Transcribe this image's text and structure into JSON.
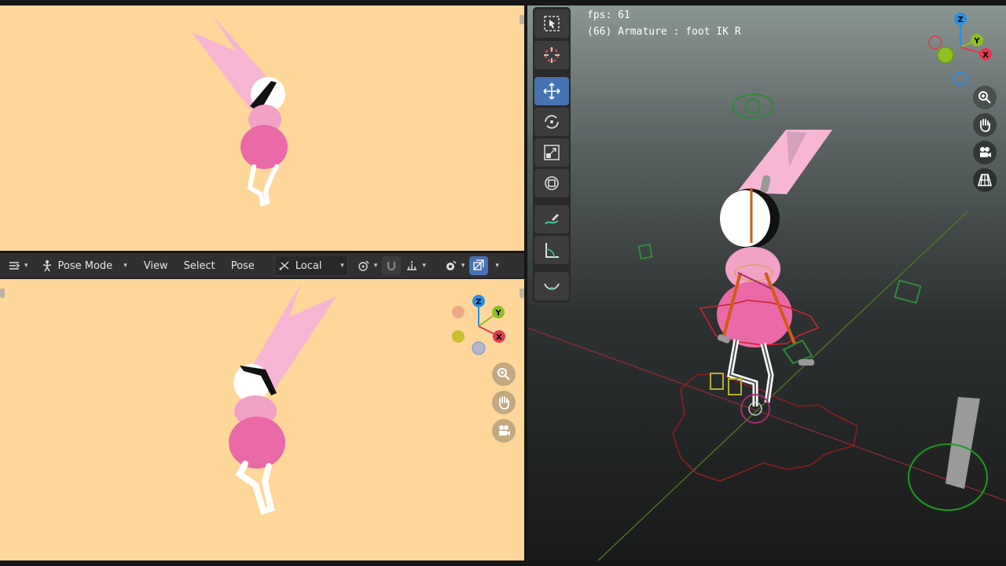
{
  "header": {
    "editor_type_icon": "editor-type-icon",
    "mode_label": "Pose Mode",
    "menus": [
      "View",
      "Select",
      "Pose"
    ],
    "transform_orientation": "Local",
    "pivot_icon": "pivot-icon",
    "snap_icon": "snap-icon",
    "proportional_icon": "proportional-edit-icon",
    "overlay_icon": "overlay-eye-icon",
    "xray_icon": "xray-icon"
  },
  "viewport3d": {
    "fps_text": "fps: 61",
    "selection_info": "(66) Armature : foot IK R",
    "gizmo_axes": {
      "x": "X",
      "y": "Y",
      "z": "Z"
    },
    "nav_icons": [
      "zoom-icon",
      "pan-hand-icon",
      "camera-icon",
      "perspective-grid-icon"
    ]
  },
  "bottom_viewport": {
    "gizmo_axes": {
      "x": "X",
      "y": "Y",
      "z": "Z"
    },
    "nav_icons": [
      "zoom-icon",
      "pan-hand-icon",
      "camera-icon"
    ]
  },
  "toolbar": {
    "tools": [
      "select-box-icon",
      "cursor-icon",
      "move-icon",
      "rotate-icon",
      "scale-icon",
      "transform-icon",
      "annotate-icon",
      "measure-icon",
      "relax-pose-icon"
    ],
    "active_tool": "move-icon"
  },
  "colors": {
    "camera_bg": "#ffd79a",
    "axis_x": "#e23a4d",
    "axis_y": "#8fbf23",
    "axis_z": "#2a8fe0",
    "active_blue": "#4772b3",
    "character_pink": "#f2a7c9",
    "body_pink": "#e96aa6"
  }
}
